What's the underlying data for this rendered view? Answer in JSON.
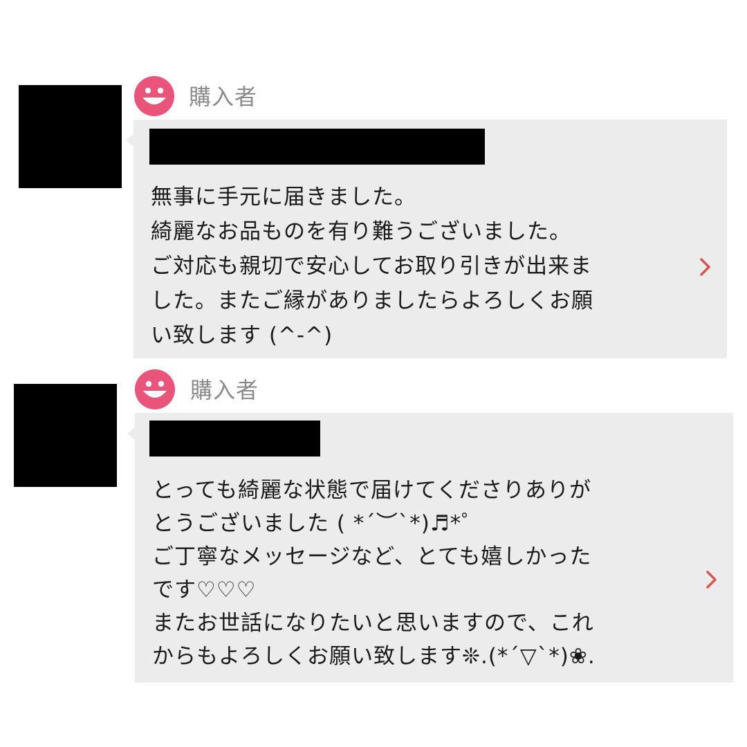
{
  "reviews": [
    {
      "role_label": "購入者",
      "message": "無事に手元に届きました。\n綺麗なお品ものを有り難うございました。\nご対応も親切で安心してお取り引きが出来ま\nした。またご縁がありましたらよろしくお願\nい致します (^-^)",
      "avatar_icon": "smiley-face-icon",
      "detail_icon": "chevron-right-icon",
      "redacted_username": true,
      "redacted_profile_image": true
    },
    {
      "role_label": "購入者",
      "message": "とっても綺麗な状態で届けてくださりありが\nとうございました ( *´︶`*)♬*゜\nご丁寧なメッセージなど、とても嬉しかった\nです♡♡♡\nまたお世話になりたいと思いますので、これ\nからもよろしくお願い致します❊.(*´▽`*)❀.",
      "avatar_icon": "smiley-face-icon",
      "detail_icon": "chevron-right-icon",
      "redacted_username": true,
      "redacted_profile_image": true
    }
  ],
  "colors": {
    "avatar_pink": "#e8547a",
    "bubble_bg": "#ececec",
    "chevron_red": "#d9534f",
    "label_gray": "#8a8a8a"
  }
}
